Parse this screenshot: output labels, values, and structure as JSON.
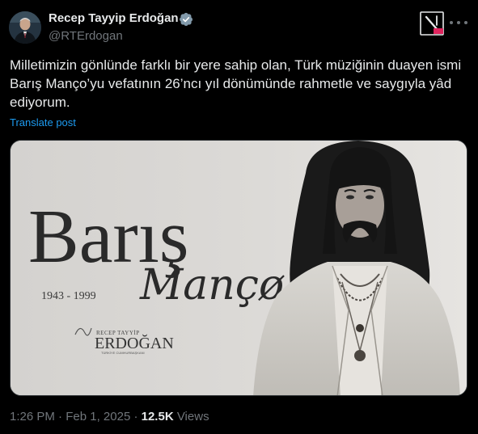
{
  "author": {
    "name": "Recep Tayyip Erdoğan",
    "handle": "@RTErdogan",
    "verified": true
  },
  "post": {
    "text": "Milletimizin gönlünde farklı bir yere sahip olan, Türk müziğinin duayen ismi Barış Manço’yu vefatının 26’ncı yıl dönümünde rahmetle ve saygıyla yâd ediyorum.",
    "translate_label": "Translate post",
    "time": "1:26 PM",
    "separator": "·",
    "date": "Feb 1, 2025",
    "views_count": "12.5K",
    "views_label": "Views"
  },
  "media": {
    "title_first": "Barış",
    "title_second": "Mançø",
    "years": "1943 - 1999",
    "signature_top": "RECEP TAYYİP",
    "signature_name": "ERDOĞAN",
    "signature_sub": "TÜRKİYE CUMHURBAŞKANI"
  },
  "colors": {
    "background": "#000000",
    "text": "#e7e9ea",
    "muted": "#71767b",
    "link": "#1d9bf0",
    "verified": "#829aab"
  },
  "icons": {
    "verified": "verified-badge-icon",
    "grok": "grok-icon",
    "more": "more-icon"
  }
}
